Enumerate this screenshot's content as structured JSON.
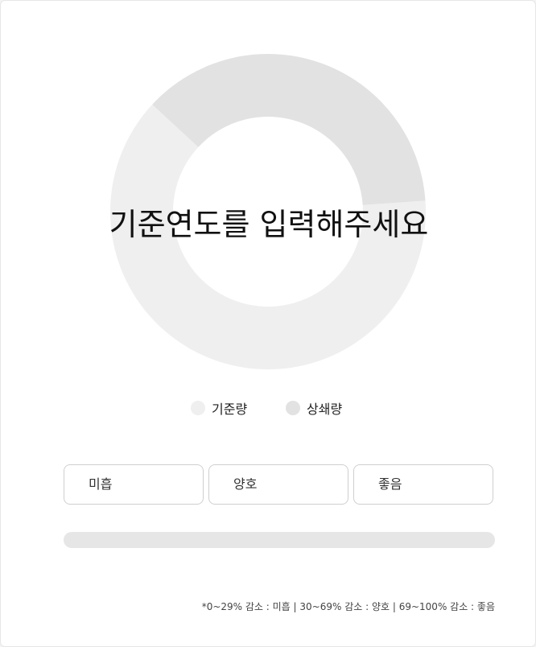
{
  "message": "기준연도를 입력해주세요",
  "chart_data": {
    "type": "pie",
    "series": [
      {
        "name": "기준량",
        "value": 63,
        "color": "#efefef"
      },
      {
        "name": "상쇄량",
        "value": 37,
        "color": "#e2e2e2"
      }
    ]
  },
  "legend": {
    "items": [
      {
        "label": "기준량",
        "color": "#efefef"
      },
      {
        "label": "상쇄량",
        "color": "#e2e2e2"
      }
    ]
  },
  "levels": [
    {
      "label": "미흡"
    },
    {
      "label": "양호"
    },
    {
      "label": "좋음"
    }
  ],
  "progress": {
    "percent": 0
  },
  "footnote": "*0~29% 감소 : 미흡  |   30~69% 감소 : 양호  |  69~100% 감소 : 좋음"
}
